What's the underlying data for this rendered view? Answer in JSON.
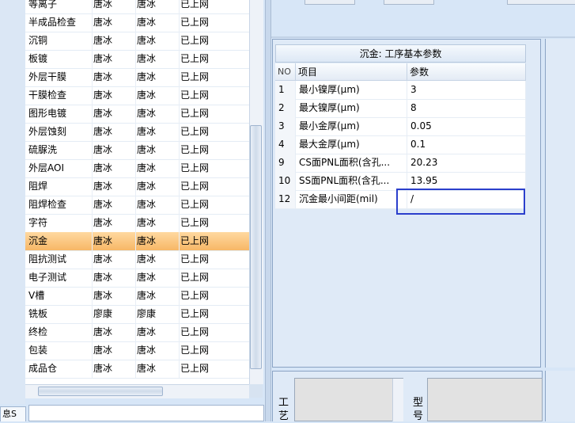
{
  "process_list": {
    "rows": [
      {
        "name": "等离子",
        "user1": "唐冰",
        "user2": "唐冰",
        "status": "已上网"
      },
      {
        "name": "半成品检查",
        "user1": "唐冰",
        "user2": "唐冰",
        "status": "已上网"
      },
      {
        "name": "沉铜",
        "user1": "唐冰",
        "user2": "唐冰",
        "status": "已上网"
      },
      {
        "name": "板镀",
        "user1": "唐冰",
        "user2": "唐冰",
        "status": "已上网"
      },
      {
        "name": "外层干膜",
        "user1": "唐冰",
        "user2": "唐冰",
        "status": "已上网"
      },
      {
        "name": "干膜检查",
        "user1": "唐冰",
        "user2": "唐冰",
        "status": "已上网"
      },
      {
        "name": "图形电镀",
        "user1": "唐冰",
        "user2": "唐冰",
        "status": "已上网"
      },
      {
        "name": "外层蚀刻",
        "user1": "唐冰",
        "user2": "唐冰",
        "status": "已上网"
      },
      {
        "name": "硫脲洗",
        "user1": "唐冰",
        "user2": "唐冰",
        "status": "已上网"
      },
      {
        "name": "外层AOI",
        "user1": "唐冰",
        "user2": "唐冰",
        "status": "已上网"
      },
      {
        "name": "阻焊",
        "user1": "唐冰",
        "user2": "唐冰",
        "status": "已上网"
      },
      {
        "name": "阻焊检查",
        "user1": "唐冰",
        "user2": "唐冰",
        "status": "已上网"
      },
      {
        "name": "字符",
        "user1": "唐冰",
        "user2": "唐冰",
        "status": "已上网"
      },
      {
        "name": "沉金",
        "user1": "唐冰",
        "user2": "唐冰",
        "status": "已上网",
        "selected": true
      },
      {
        "name": "阻抗测试",
        "user1": "唐冰",
        "user2": "唐冰",
        "status": "已上网"
      },
      {
        "name": "电子测试",
        "user1": "唐冰",
        "user2": "唐冰",
        "status": "已上网"
      },
      {
        "name": "V槽",
        "user1": "唐冰",
        "user2": "唐冰",
        "status": "已上网"
      },
      {
        "name": "铣板",
        "user1": "廖康",
        "user2": "廖康",
        "status": "已上网"
      },
      {
        "name": "终检",
        "user1": "唐冰",
        "user2": "唐冰",
        "status": "已上网"
      },
      {
        "name": "包装",
        "user1": "唐冰",
        "user2": "唐冰",
        "status": "已上网"
      },
      {
        "name": "成品仓",
        "user1": "唐冰",
        "user2": "唐冰",
        "status": "已上网"
      }
    ]
  },
  "bottom_tab": {
    "label": "息S"
  },
  "params_panel": {
    "title": "沉金: 工序基本参数",
    "headers": {
      "no": "NO",
      "item": "项目",
      "value": "参数"
    },
    "rows": [
      {
        "no": "1",
        "item": "最小镍厚(μm)",
        "value": "3"
      },
      {
        "no": "2",
        "item": "最大镍厚(μm)",
        "value": "8"
      },
      {
        "no": "3",
        "item": "最小金厚(μm)",
        "value": "0.05"
      },
      {
        "no": "4",
        "item": "最大金厚(μm)",
        "value": "0.1"
      },
      {
        "no": "9",
        "item": "CS面PNL面积(含孔...",
        "value": "20.23"
      },
      {
        "no": "10",
        "item": "SS面PNL面积(含孔...",
        "value": "13.95"
      },
      {
        "no": "12",
        "item": "沉金最小间距(mil)",
        "value": "/"
      }
    ]
  },
  "bottom_labels": {
    "craft": "工艺",
    "model": "型号"
  },
  "colors": {
    "selected_row": "#f7b766",
    "focus_border": "#2b3fcc",
    "panel_bg": "#dfeaf7"
  }
}
